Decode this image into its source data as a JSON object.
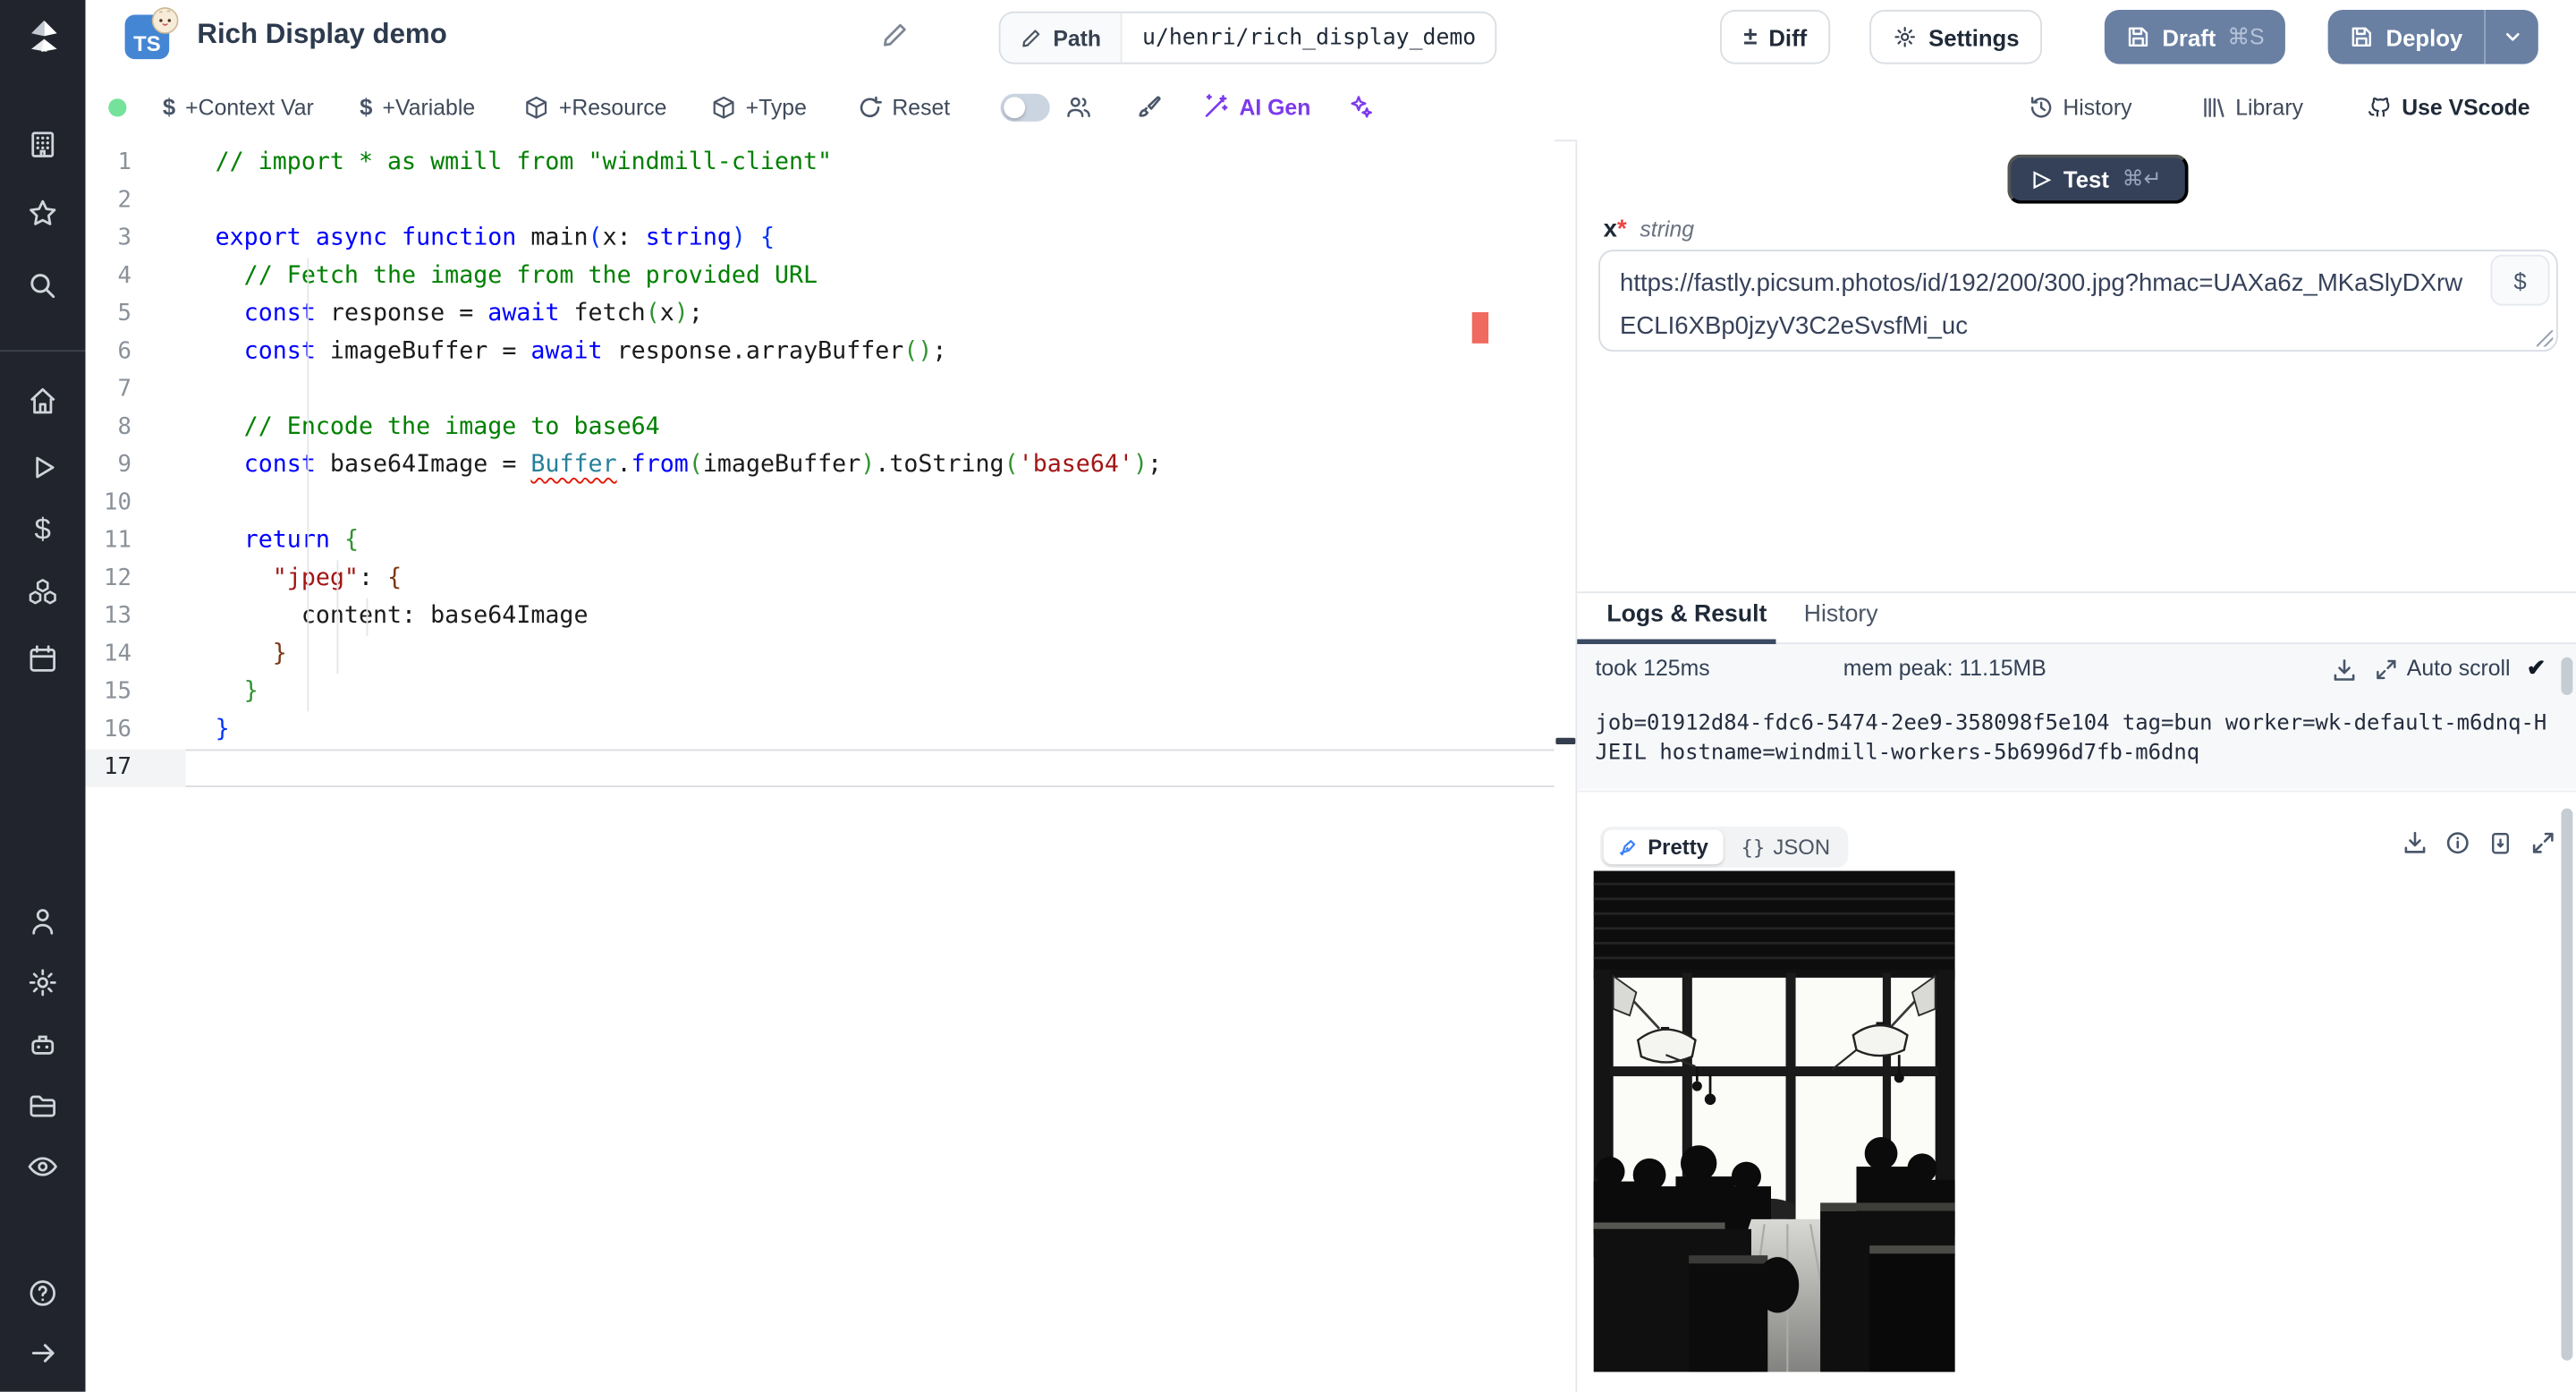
{
  "header": {
    "title": "Rich Display demo",
    "lang_badge": "TS",
    "path_label": "Path",
    "path_value": "u/henri/rich_display_demo",
    "diff_label": "Diff",
    "settings_label": "Settings",
    "draft_label": "Draft",
    "draft_shortcut": "⌘S",
    "deploy_label": "Deploy"
  },
  "toolbar": {
    "context_var_label": "+Context Var",
    "variable_label": "+Variable",
    "resource_label": "+Resource",
    "type_label": "+Type",
    "reset_label": "Reset",
    "ai_gen_label": "AI Gen",
    "history_label": "History",
    "library_label": "Library",
    "use_vscode_label": "Use VScode"
  },
  "icons": {
    "diff_glyph": "±",
    "dollar_glyph": "$",
    "play_glyph": "▷",
    "caret_glyph": "⌄",
    "check_glyph": "✔",
    "arrow_right_glyph": "→",
    "star_glyph": "☆",
    "question_glyph": "?",
    "braces_glyph": "{}"
  },
  "editor": {
    "lines": [
      {
        "n": "1",
        "t": [
          [
            "// import * as wmill from \"windmill-client\"",
            "c"
          ]
        ]
      },
      {
        "n": "2",
        "t": []
      },
      {
        "n": "3",
        "t": [
          [
            "export async function ",
            "k"
          ],
          [
            "main",
            "p"
          ],
          [
            "(",
            "b1"
          ],
          [
            "x",
            "p"
          ],
          [
            ": ",
            "p"
          ],
          [
            "string",
            "k"
          ],
          [
            ")",
            "b1"
          ],
          [
            " ",
            "p"
          ],
          [
            "{",
            "b1"
          ]
        ]
      },
      {
        "n": "4",
        "t": [
          [
            "  // Fetch the image from the provided URL",
            "c"
          ]
        ]
      },
      {
        "n": "5",
        "t": [
          [
            "  ",
            "p"
          ],
          [
            "const",
            "k"
          ],
          [
            " response = ",
            "p"
          ],
          [
            "await",
            "k"
          ],
          [
            " fetch",
            "p"
          ],
          [
            "(",
            "b2"
          ],
          [
            "x",
            "p"
          ],
          [
            ")",
            "b2"
          ],
          [
            ";",
            "p"
          ]
        ]
      },
      {
        "n": "6",
        "t": [
          [
            "  ",
            "p"
          ],
          [
            "const",
            "k"
          ],
          [
            " imageBuffer = ",
            "p"
          ],
          [
            "await",
            "k"
          ],
          [
            " response.arrayBuffer",
            "p"
          ],
          [
            "(",
            "b2"
          ],
          [
            ")",
            "b2"
          ],
          [
            ";",
            "p"
          ]
        ]
      },
      {
        "n": "7",
        "t": []
      },
      {
        "n": "8",
        "t": [
          [
            "  // Encode the image to base64",
            "c"
          ]
        ]
      },
      {
        "n": "9",
        "t": [
          [
            "  ",
            "p"
          ],
          [
            "const",
            "k"
          ],
          [
            " base64Image = ",
            "p"
          ],
          [
            "Buffer",
            "te"
          ],
          [
            ".",
            "p"
          ],
          [
            "from",
            "k"
          ],
          [
            "(",
            "b2"
          ],
          [
            "imageBuffer",
            "p"
          ],
          [
            ")",
            "b2"
          ],
          [
            ".toString",
            "p"
          ],
          [
            "(",
            "b2"
          ],
          [
            "'base64'",
            "s"
          ],
          [
            ")",
            "b2"
          ],
          [
            ";",
            "p"
          ]
        ]
      },
      {
        "n": "10",
        "t": []
      },
      {
        "n": "11",
        "t": [
          [
            "  ",
            "p"
          ],
          [
            "return",
            "k"
          ],
          [
            " ",
            "p"
          ],
          [
            "{",
            "b2"
          ]
        ]
      },
      {
        "n": "12",
        "t": [
          [
            "    ",
            "p"
          ],
          [
            "\"jpeg\"",
            "s"
          ],
          [
            ": ",
            "p"
          ],
          [
            "{",
            "b3"
          ]
        ]
      },
      {
        "n": "13",
        "t": [
          [
            "      content: base64Image",
            "p"
          ]
        ]
      },
      {
        "n": "14",
        "t": [
          [
            "    ",
            "p"
          ],
          [
            "}",
            "b3"
          ]
        ]
      },
      {
        "n": "15",
        "t": [
          [
            "  ",
            "p"
          ],
          [
            "}",
            "b2"
          ]
        ]
      },
      {
        "n": "16",
        "t": [
          [
            "}",
            "b1"
          ]
        ]
      },
      {
        "n": "17",
        "t": [],
        "active": true
      }
    ]
  },
  "run_panel": {
    "test_label": "Test",
    "test_shortcut": "⌘↵",
    "arg_name": "x",
    "arg_required": "*",
    "arg_type": "string",
    "arg_value": "https://fastly.picsum.photos/id/192/200/300.jpg?hmac=UAXa6z_MKaSlyDXrwECLI6XBp0jzyV3C2eSvsfMi_uc",
    "var_button": "$"
  },
  "bottom_panel": {
    "tab_logs": "Logs & Result",
    "tab_history": "History",
    "took": "took 125ms",
    "mem_peak": "mem peak: 11.15MB",
    "auto_scroll": "Auto scroll",
    "log_text": "job=01912d84-fdc6-5474-2ee9-358098f5e104 tag=bun worker=wk-default-m6dnq-HJEIL hostname=windmill-workers-5b6996d7fb-m6dnq"
  },
  "result_panel": {
    "pretty_label": "Pretty",
    "json_label": "JSON"
  },
  "colors": {
    "accent_slate_button": "#6980a3",
    "test_button": "#344159",
    "ai_purple": "#7c3aed",
    "green_status": "#74e29b",
    "error_marker": "#f16a5f",
    "ts_badge": "#4486d3",
    "sidebar_bg": "#21242c"
  }
}
